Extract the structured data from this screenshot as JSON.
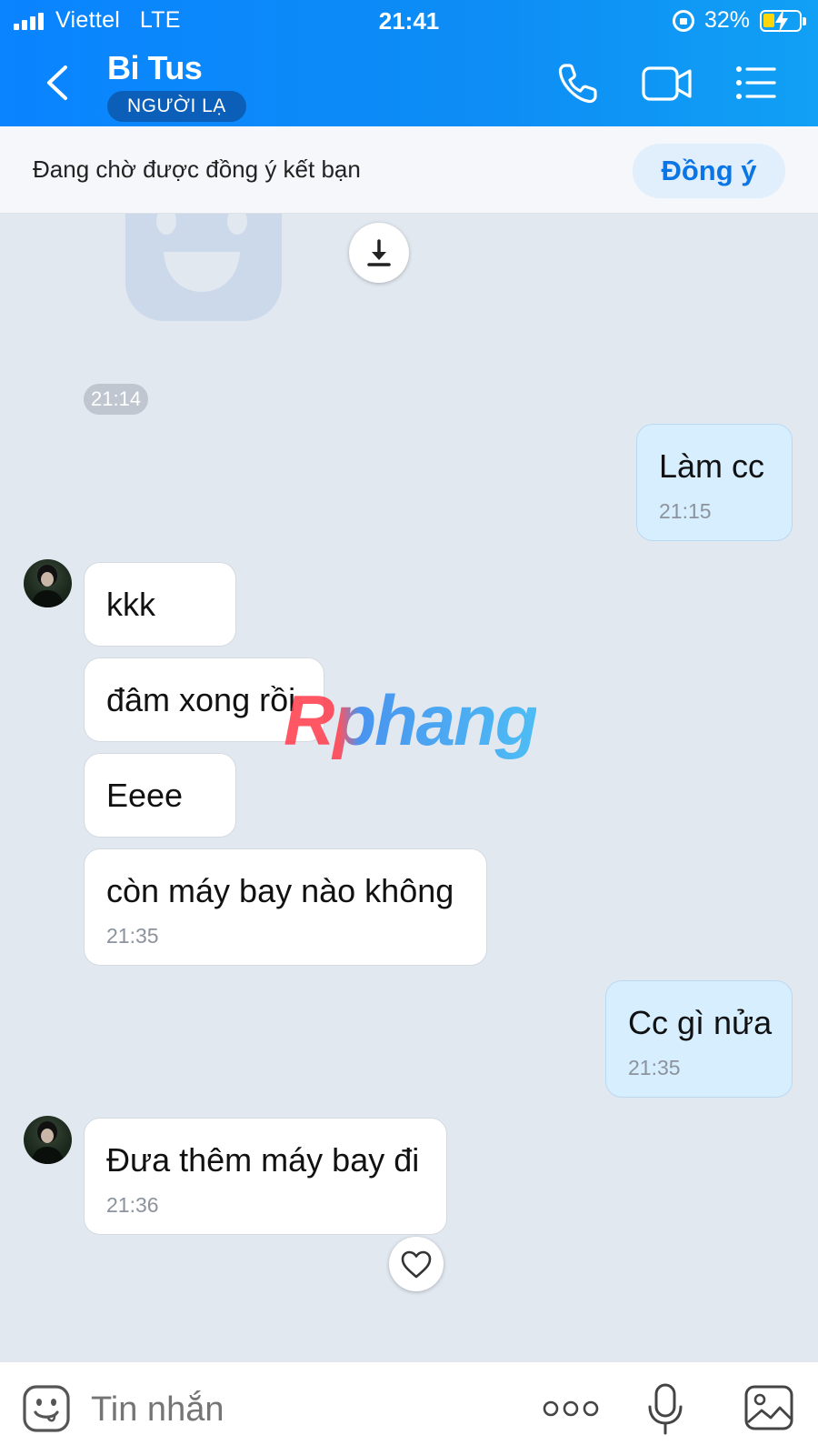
{
  "status_bar": {
    "carrier": "Viettel",
    "network": "LTE",
    "time": "21:41",
    "battery_percent": "32%",
    "battery_level": 0.32
  },
  "header": {
    "contact_name": "Bi Tus",
    "badge": "NGƯỜI LẠ",
    "icons": [
      "back-icon",
      "phone-icon",
      "video-camera-icon",
      "menu-list-icon"
    ]
  },
  "friend_request": {
    "status_text": "Đang chờ được đồng ý kết bạn",
    "accept_label": "Đồng ý"
  },
  "chat": {
    "sticker_time": "21:14",
    "messages": [
      {
        "direction": "out",
        "text": "Làm cc",
        "time": "21:15"
      },
      {
        "direction": "in",
        "text": "kkk",
        "time": ""
      },
      {
        "direction": "in",
        "text": "đâm xong rồi",
        "time": ""
      },
      {
        "direction": "in",
        "text": "Eeee",
        "time": ""
      },
      {
        "direction": "in",
        "text": "còn máy bay nào không",
        "time": "21:35"
      },
      {
        "direction": "out",
        "text": "Cc gì nửa",
        "time": "21:35"
      },
      {
        "direction": "in",
        "text": "Đưa thêm máy bay đi",
        "time": "21:36"
      }
    ],
    "watermark": "Rphang"
  },
  "composer": {
    "placeholder": "Tin nhắn",
    "icons": [
      "emoji-icon",
      "more-dots-icon",
      "microphone-icon",
      "image-icon"
    ]
  },
  "colors": {
    "header_blue": "#0a84ff",
    "accent_blue": "#0a76e6",
    "outgoing_bubble": "#d6eefe",
    "incoming_bubble": "#ffffff",
    "chat_background": "#e2e8f0"
  }
}
